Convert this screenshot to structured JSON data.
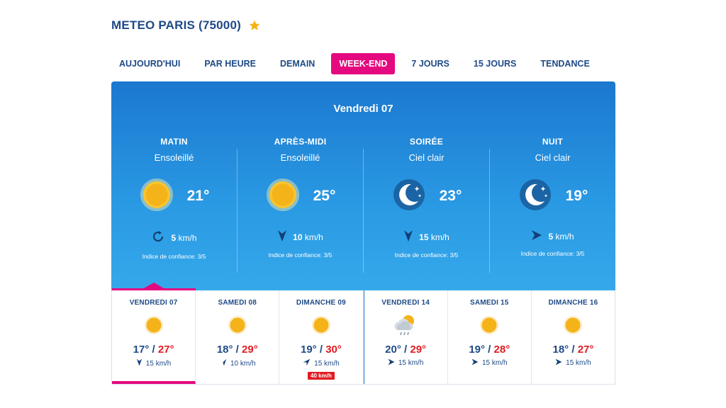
{
  "header": {
    "title": "METEO PARIS (75000)",
    "fav_icon": "star-icon"
  },
  "tabs": [
    {
      "label": "AUJOURD'HUI"
    },
    {
      "label": "PAR HEURE"
    },
    {
      "label": "DEMAIN"
    },
    {
      "label": "WEEK-END",
      "active": true
    },
    {
      "label": "7 JOURS"
    },
    {
      "label": "15 JOURS"
    },
    {
      "label": "TENDANCE"
    }
  ],
  "panel": {
    "date": "Vendredi 07",
    "periods": [
      {
        "name": "MATIN",
        "condition": "Ensoleillé",
        "icon": "sun-icon",
        "temp": "21°",
        "wind_icon": "wind-variable-icon",
        "wind_speed": "5",
        "wind_unit": "km/h",
        "confidence": "Indice de confiance: 3/5"
      },
      {
        "name": "APRÈS-MIDI",
        "condition": "Ensoleillé",
        "icon": "sun-icon",
        "temp": "25°",
        "wind_icon": "wind-arrow-icon",
        "wind_speed": "10",
        "wind_unit": "km/h",
        "confidence": "Indice de confiance: 3/5"
      },
      {
        "name": "SOIRÉE",
        "condition": "Ciel clair",
        "icon": "moon-icon",
        "temp": "23°",
        "wind_icon": "wind-arrow-icon",
        "wind_speed": "15",
        "wind_unit": "km/h",
        "confidence": "Indice de confiance: 3/5"
      },
      {
        "name": "NUIT",
        "condition": "Ciel clair",
        "icon": "moon-icon",
        "temp": "19°",
        "wind_icon": "wind-arrow-icon",
        "wind_speed": "5",
        "wind_unit": "km/h",
        "confidence": "Indice de confiance: 3/5"
      }
    ]
  },
  "days": [
    {
      "name": "VENDREDI 07",
      "icon": "sun-icon",
      "min": "17°",
      "sep": " / ",
      "max": "27°",
      "wind": "15 km/h",
      "active": true
    },
    {
      "name": "SAMEDI 08",
      "icon": "sun-icon",
      "min": "18°",
      "sep": " / ",
      "max": "29°",
      "wind": "10 km/h"
    },
    {
      "name": "DIMANCHE 09",
      "icon": "sun-icon",
      "min": "19°",
      "sep": " / ",
      "max": "30°",
      "wind": "15 km/h",
      "gust": "40 km/h"
    },
    {
      "name": "VENDREDI 14",
      "icon": "sun-cloud-rain-icon",
      "min": "20°",
      "sep": " / ",
      "max": "29°",
      "wind": "15 km/h"
    },
    {
      "name": "SAMEDI 15",
      "icon": "sun-icon",
      "min": "19°",
      "sep": " / ",
      "max": "28°",
      "wind": "15 km/h"
    },
    {
      "name": "DIMANCHE 16",
      "icon": "sun-icon",
      "min": "18°",
      "sep": " / ",
      "max": "27°",
      "wind": "15 km/h"
    }
  ],
  "colors": {
    "accent": "#e5097f",
    "brand": "#1e4a86",
    "panel": "#1b78cf",
    "max_temp": "#e11b22",
    "sun": "#f5b31a"
  }
}
